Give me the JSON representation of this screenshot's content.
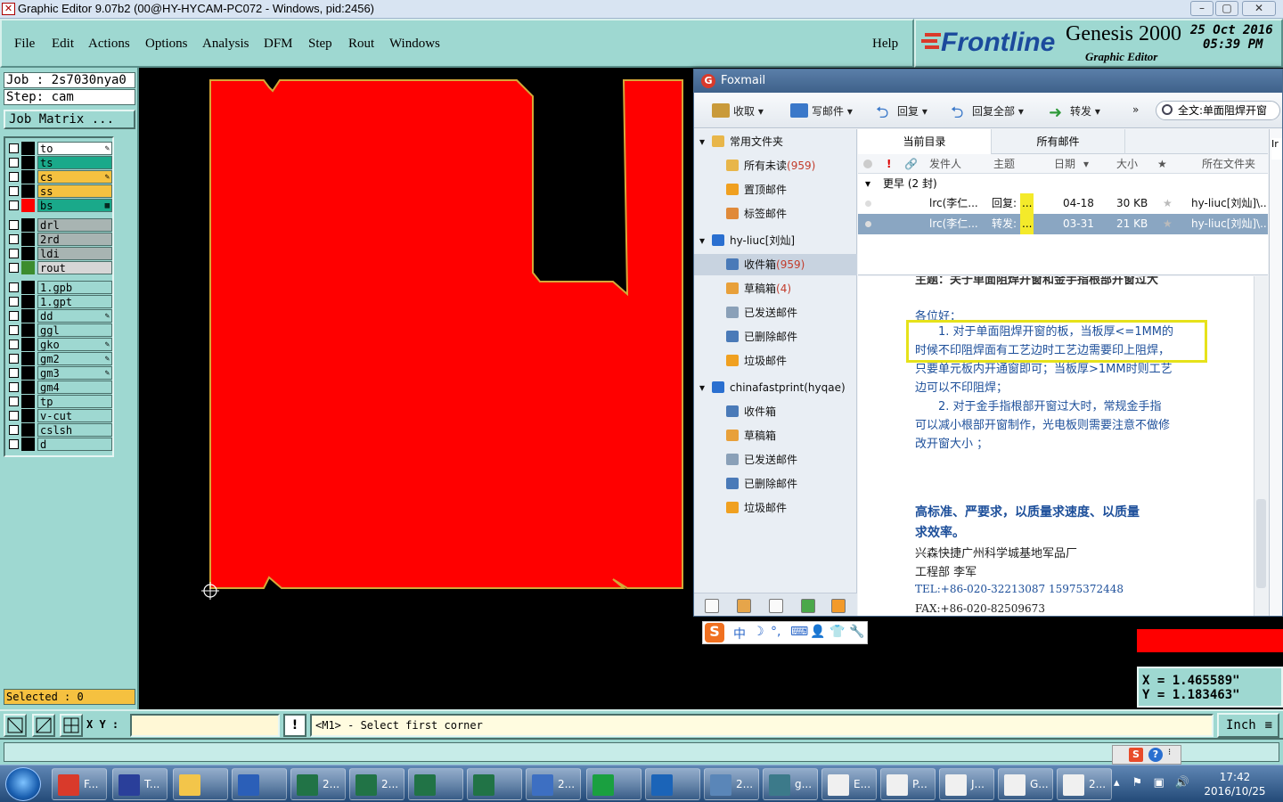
{
  "window": {
    "title": "Graphic Editor 9.07b2 (00@HY-HYCAM-PC072 - Windows, pid:2456)",
    "controls": [
      "–",
      "▢",
      "✕"
    ]
  },
  "menu": {
    "items": [
      "File",
      "Edit",
      "Actions",
      "Options",
      "Analysis",
      "DFM",
      "Step",
      "Rout",
      "Windows"
    ],
    "help": "Help"
  },
  "brand": {
    "logo": "Frontline",
    "product": "Genesis 2000",
    "subtitle": "Graphic Editor",
    "date": "25 Oct 2016",
    "time": "05:39 PM"
  },
  "left_panel": {
    "job": "Job : 2s7030nya0",
    "step": "Step: cam",
    "job_matrix": "Job Matrix ...",
    "selected": "Selected : 0",
    "layers": [
      {
        "name": "to",
        "color": "#ffffff",
        "swatch": "#000000",
        "mark": "✎"
      },
      {
        "name": "ts",
        "color": "#1aa98a",
        "swatch": "#000000",
        "mark": ""
      },
      {
        "name": "cs",
        "color": "#f5c140",
        "swatch": "#000000",
        "mark": "✎"
      },
      {
        "name": "ss",
        "color": "#f5c140",
        "swatch": "#000000",
        "mark": ""
      },
      {
        "name": "bs",
        "color": "#1aa98a",
        "swatch": "#ff0000",
        "mark": "▦"
      },
      {
        "name": "drl",
        "color": "#a8b4b2",
        "swatch": "#000000",
        "mark": ""
      },
      {
        "name": "2rd",
        "color": "#a8b4b2",
        "swatch": "#000000",
        "mark": ""
      },
      {
        "name": "ldi",
        "color": "#a8b4b2",
        "swatch": "#000000",
        "mark": ""
      },
      {
        "name": "rout",
        "color": "#d6d6d6",
        "swatch": "#3c8c2e",
        "mark": ""
      },
      {
        "name": "1.gpb",
        "color": "#9ed8d1",
        "swatch": "#000000",
        "mark": ""
      },
      {
        "name": "1.gpt",
        "color": "#9ed8d1",
        "swatch": "#000000",
        "mark": ""
      },
      {
        "name": "dd",
        "color": "#9ed8d1",
        "swatch": "#000000",
        "mark": "✎"
      },
      {
        "name": "ggl",
        "color": "#9ed8d1",
        "swatch": "#000000",
        "mark": ""
      },
      {
        "name": "gko",
        "color": "#9ed8d1",
        "swatch": "#000000",
        "mark": "✎"
      },
      {
        "name": "gm2",
        "color": "#9ed8d1",
        "swatch": "#000000",
        "mark": "✎"
      },
      {
        "name": "gm3",
        "color": "#9ed8d1",
        "swatch": "#000000",
        "mark": "✎"
      },
      {
        "name": "gm4",
        "color": "#9ed8d1",
        "swatch": "#000000",
        "mark": ""
      },
      {
        "name": "tp",
        "color": "#9ed8d1",
        "swatch": "#000000",
        "mark": ""
      },
      {
        "name": "v-cut",
        "color": "#9ed8d1",
        "swatch": "#000000",
        "mark": ""
      },
      {
        "name": "cslsh",
        "color": "#9ed8d1",
        "swatch": "#000000",
        "mark": ""
      },
      {
        "name": "d",
        "color": "#9ed8d1",
        "swatch": "#000000",
        "mark": ""
      }
    ]
  },
  "bottom": {
    "xy_label": "X Y :",
    "xy_value": "",
    "prompt": "<M1> - Select first corner",
    "unit": "Inch",
    "warn": "!"
  },
  "coords": {
    "x": "X = 1.465589\"",
    "y": "Y = 1.183463\""
  },
  "foxmail": {
    "title": "Foxmail",
    "toolbar": [
      {
        "label": "收取",
        "icon": "inbox-icon"
      },
      {
        "label": "写邮件",
        "icon": "pen-icon"
      },
      {
        "label": "回复",
        "icon": "reply-icon"
      },
      {
        "label": "回复全部",
        "icon": "reply-all-icon"
      },
      {
        "label": "转发",
        "icon": "forward-icon"
      }
    ],
    "more": "»",
    "search": "全文:单面阻焊开窗",
    "folders": [
      {
        "label": "常用文件夹",
        "count": "",
        "level": 0,
        "kind": "group"
      },
      {
        "label": "所有未读",
        "count": "(959)",
        "level": 1,
        "kind": "folder"
      },
      {
        "label": "置顶邮件",
        "count": "",
        "level": 1,
        "kind": "star"
      },
      {
        "label": "标签邮件",
        "count": "",
        "level": 1,
        "kind": "tag"
      },
      {
        "label": "hy-liuc[刘灿]",
        "count": "",
        "level": 0,
        "kind": "account"
      },
      {
        "label": "收件箱",
        "count": "(959)",
        "level": 1,
        "kind": "inbox",
        "selected": true
      },
      {
        "label": "草稿箱",
        "count": "(4)",
        "level": 1,
        "kind": "draft"
      },
      {
        "label": "已发送邮件",
        "count": "",
        "level": 1,
        "kind": "sent"
      },
      {
        "label": "已删除邮件",
        "count": "",
        "level": 1,
        "kind": "trash"
      },
      {
        "label": "垃圾邮件",
        "count": "",
        "level": 1,
        "kind": "junk"
      },
      {
        "label": "chinafastprint(hyqae)",
        "count": "",
        "level": 0,
        "kind": "account"
      },
      {
        "label": "收件箱",
        "count": "",
        "level": 1,
        "kind": "inbox"
      },
      {
        "label": "草稿箱",
        "count": "",
        "level": 1,
        "kind": "draft"
      },
      {
        "label": "已发送邮件",
        "count": "",
        "level": 1,
        "kind": "sent"
      },
      {
        "label": "已删除邮件",
        "count": "",
        "level": 1,
        "kind": "trash"
      },
      {
        "label": "垃圾邮件",
        "count": "",
        "level": 1,
        "kind": "junk"
      }
    ],
    "tabs": [
      "当前目录",
      "所有邮件"
    ],
    "columns": {
      "sender": "发件人",
      "subject": "主题",
      "date": "日期",
      "size": "大小",
      "folder": "所在文件夹",
      "flag": "!"
    },
    "group": "更早 (2 封)",
    "messages": [
      {
        "sender": "lrc(李仁...",
        "subject": "回复:",
        "hl": "...",
        "date": "04-18",
        "size": "30 KB",
        "folder": "hy-liuc[刘灿]\\..."
      },
      {
        "sender": "lrc(李仁...",
        "subject": "转发:",
        "hl": "...",
        "date": "03-31",
        "size": "21 KB",
        "folder": "hy-liuc[刘灿]\\..."
      }
    ],
    "reader": {
      "subject_partial": "主题：关于单面阻焊开窗和金手指根部开窗过大",
      "greeting": "各位好：",
      "p1_lines": [
        "1.   对于单面阻焊开窗的板，当板厚<=1MM的",
        "时候不印阻焊面有工艺边时工艺边需要印上阻焊，",
        "只要单元板内开通窗即可；当板厚>1MM时则工艺",
        "边可以不印阻焊；"
      ],
      "p2_lines": [
        "2.   对于金手指根部开窗过大时，常规金手指",
        "可以减小根部开窗制作，光电板则需要注意不做修",
        "改开窗大小   ；"
      ],
      "motto_lines": [
        "高标准、严要求，以质量求速度、以质量",
        "求效率。"
      ],
      "company": "兴森快捷广州科学城基地军品厂",
      "dept": "工程部   李军",
      "tel": "TEL:+86-020-32213087     15975372448",
      "fax": "FAX:+86-020-82509673"
    }
  },
  "ime": {
    "items": [
      "中",
      "☽",
      "°,",
      "⌨",
      "👤",
      "👕",
      "🔧"
    ]
  },
  "taskbar": {
    "items": [
      {
        "label": "F...",
        "color": "#d93a2b"
      },
      {
        "label": "T...",
        "color": "#2a3f9a"
      },
      {
        "label": "",
        "color": "#f3c54a"
      },
      {
        "label": "",
        "color": "#2b5fb8"
      },
      {
        "label": "2...",
        "color": "#217346"
      },
      {
        "label": "2...",
        "color": "#217346"
      },
      {
        "label": "",
        "color": "#217346"
      },
      {
        "label": "",
        "color": "#217346"
      },
      {
        "label": "2...",
        "color": "#3d6fc2"
      },
      {
        "label": "",
        "color": "#1aa040"
      },
      {
        "label": "",
        "color": "#1b64b8"
      },
      {
        "label": "2...",
        "color": "#5a86b8"
      },
      {
        "label": "g...",
        "color": "#3c7a8a"
      },
      {
        "label": "E...",
        "color": "#f0f0f0"
      },
      {
        "label": "P...",
        "color": "#f0f0f0"
      },
      {
        "label": "J...",
        "color": "#f0f0f0"
      },
      {
        "label": "G...",
        "color": "#f0f0f0"
      },
      {
        "label": "2...",
        "color": "#f0f0f0"
      }
    ],
    "time": "17:42",
    "date": "2016/10/25"
  }
}
